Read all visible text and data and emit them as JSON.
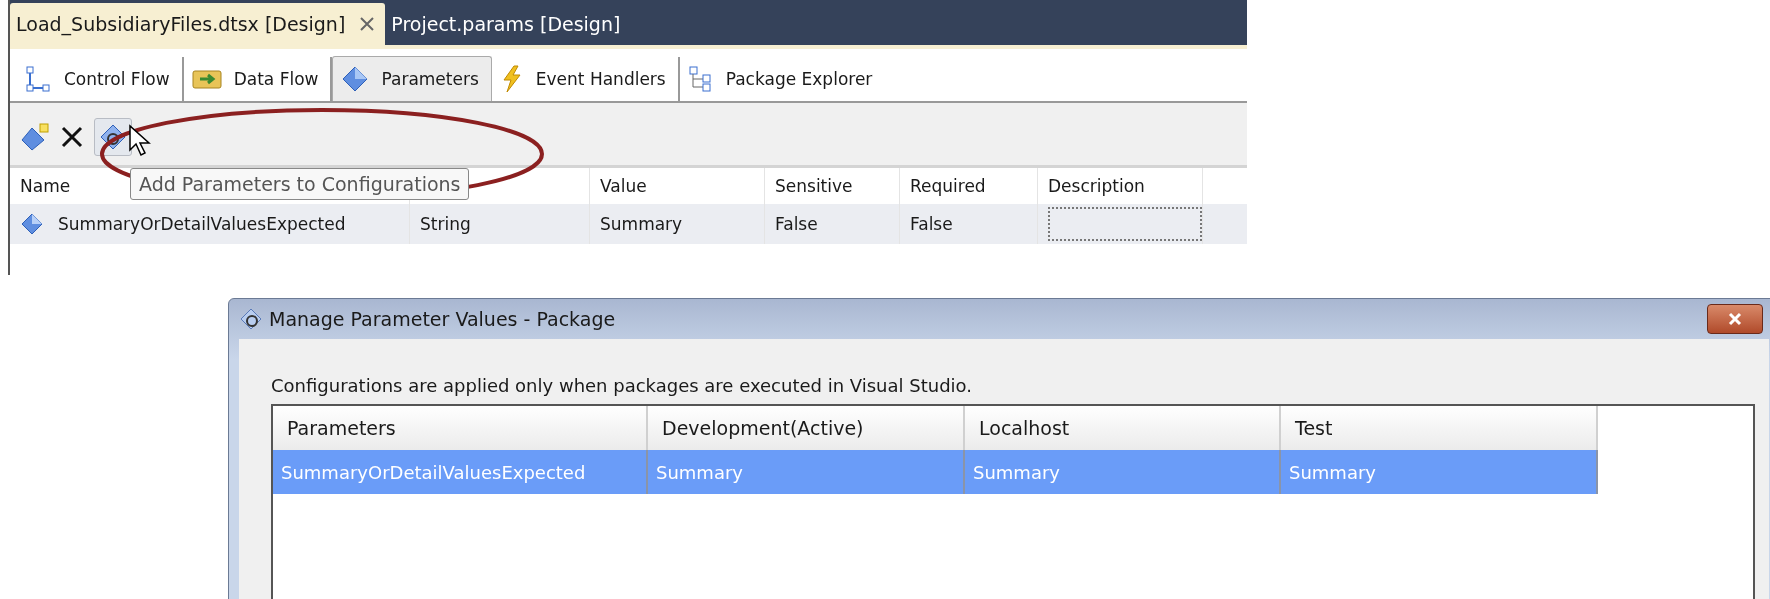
{
  "document_tabs": [
    {
      "label": "Load_SubsidiaryFiles.dtsx [Design]",
      "selected": true,
      "closable": true
    },
    {
      "label": "Project.params [Design]",
      "selected": false,
      "closable": false
    }
  ],
  "designer_tabs": [
    {
      "label": "Control Flow",
      "kind": "flow",
      "selected": false
    },
    {
      "label": "Data Flow",
      "kind": "data",
      "selected": false
    },
    {
      "label": "Parameters",
      "kind": "parameters",
      "selected": true
    },
    {
      "label": "Event Handlers",
      "kind": "events",
      "selected": false
    },
    {
      "label": "Package Explorer",
      "kind": "explorer",
      "selected": false
    }
  ],
  "toolbar": {
    "tooltip": "Add Parameters to Configurations"
  },
  "parameters_table": {
    "columns": [
      {
        "label": "Name"
      },
      {},
      {
        "label": "Value"
      },
      {
        "label": "Sensitive"
      },
      {
        "label": "Required"
      },
      {
        "label": "Description"
      }
    ],
    "rows": [
      {
        "selected": false,
        "cells": [
          "SummaryOrDetailValuesExpected",
          "String",
          "Summary",
          "False",
          "False"
        ],
        "description_focused": true
      }
    ]
  },
  "dialog": {
    "title": "Manage Parameter Values - Package",
    "message": "Configurations are applied only when packages are executed in Visual Studio.",
    "columns": [
      "Parameters",
      "Development(Active)",
      "Localhost",
      "Test"
    ],
    "rows": [
      {
        "selected": true,
        "cells": [
          "SummaryOrDetailValuesExpected",
          "Summary",
          "Summary",
          "Summary"
        ]
      }
    ]
  }
}
